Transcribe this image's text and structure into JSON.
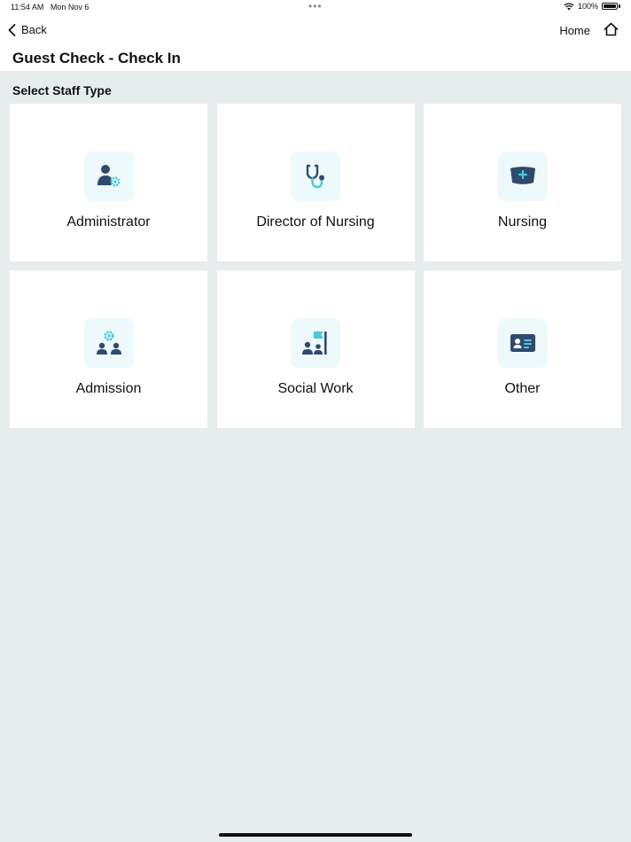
{
  "status_bar": {
    "time": "11:54 AM",
    "date": "Mon Nov 6",
    "battery": "100%"
  },
  "nav": {
    "back_label": "Back",
    "home_label": "Home"
  },
  "page": {
    "title": "Guest Check - Check In",
    "section_title": "Select Staff Type"
  },
  "staff_types": [
    {
      "label": "Administrator",
      "icon": "user-gear-icon"
    },
    {
      "label": "Director of Nursing",
      "icon": "stethoscope-icon"
    },
    {
      "label": "Nursing",
      "icon": "nurse-cap-icon"
    },
    {
      "label": "Admission",
      "icon": "people-gear-icon"
    },
    {
      "label": "Social Work",
      "icon": "people-flag-icon"
    },
    {
      "label": "Other",
      "icon": "id-card-icon"
    }
  ],
  "colors": {
    "icon_dark": "#2f4a6d",
    "icon_accent": "#4fc7df",
    "icon_bg": "#eef9fc",
    "page_bg": "#e7ecec"
  }
}
